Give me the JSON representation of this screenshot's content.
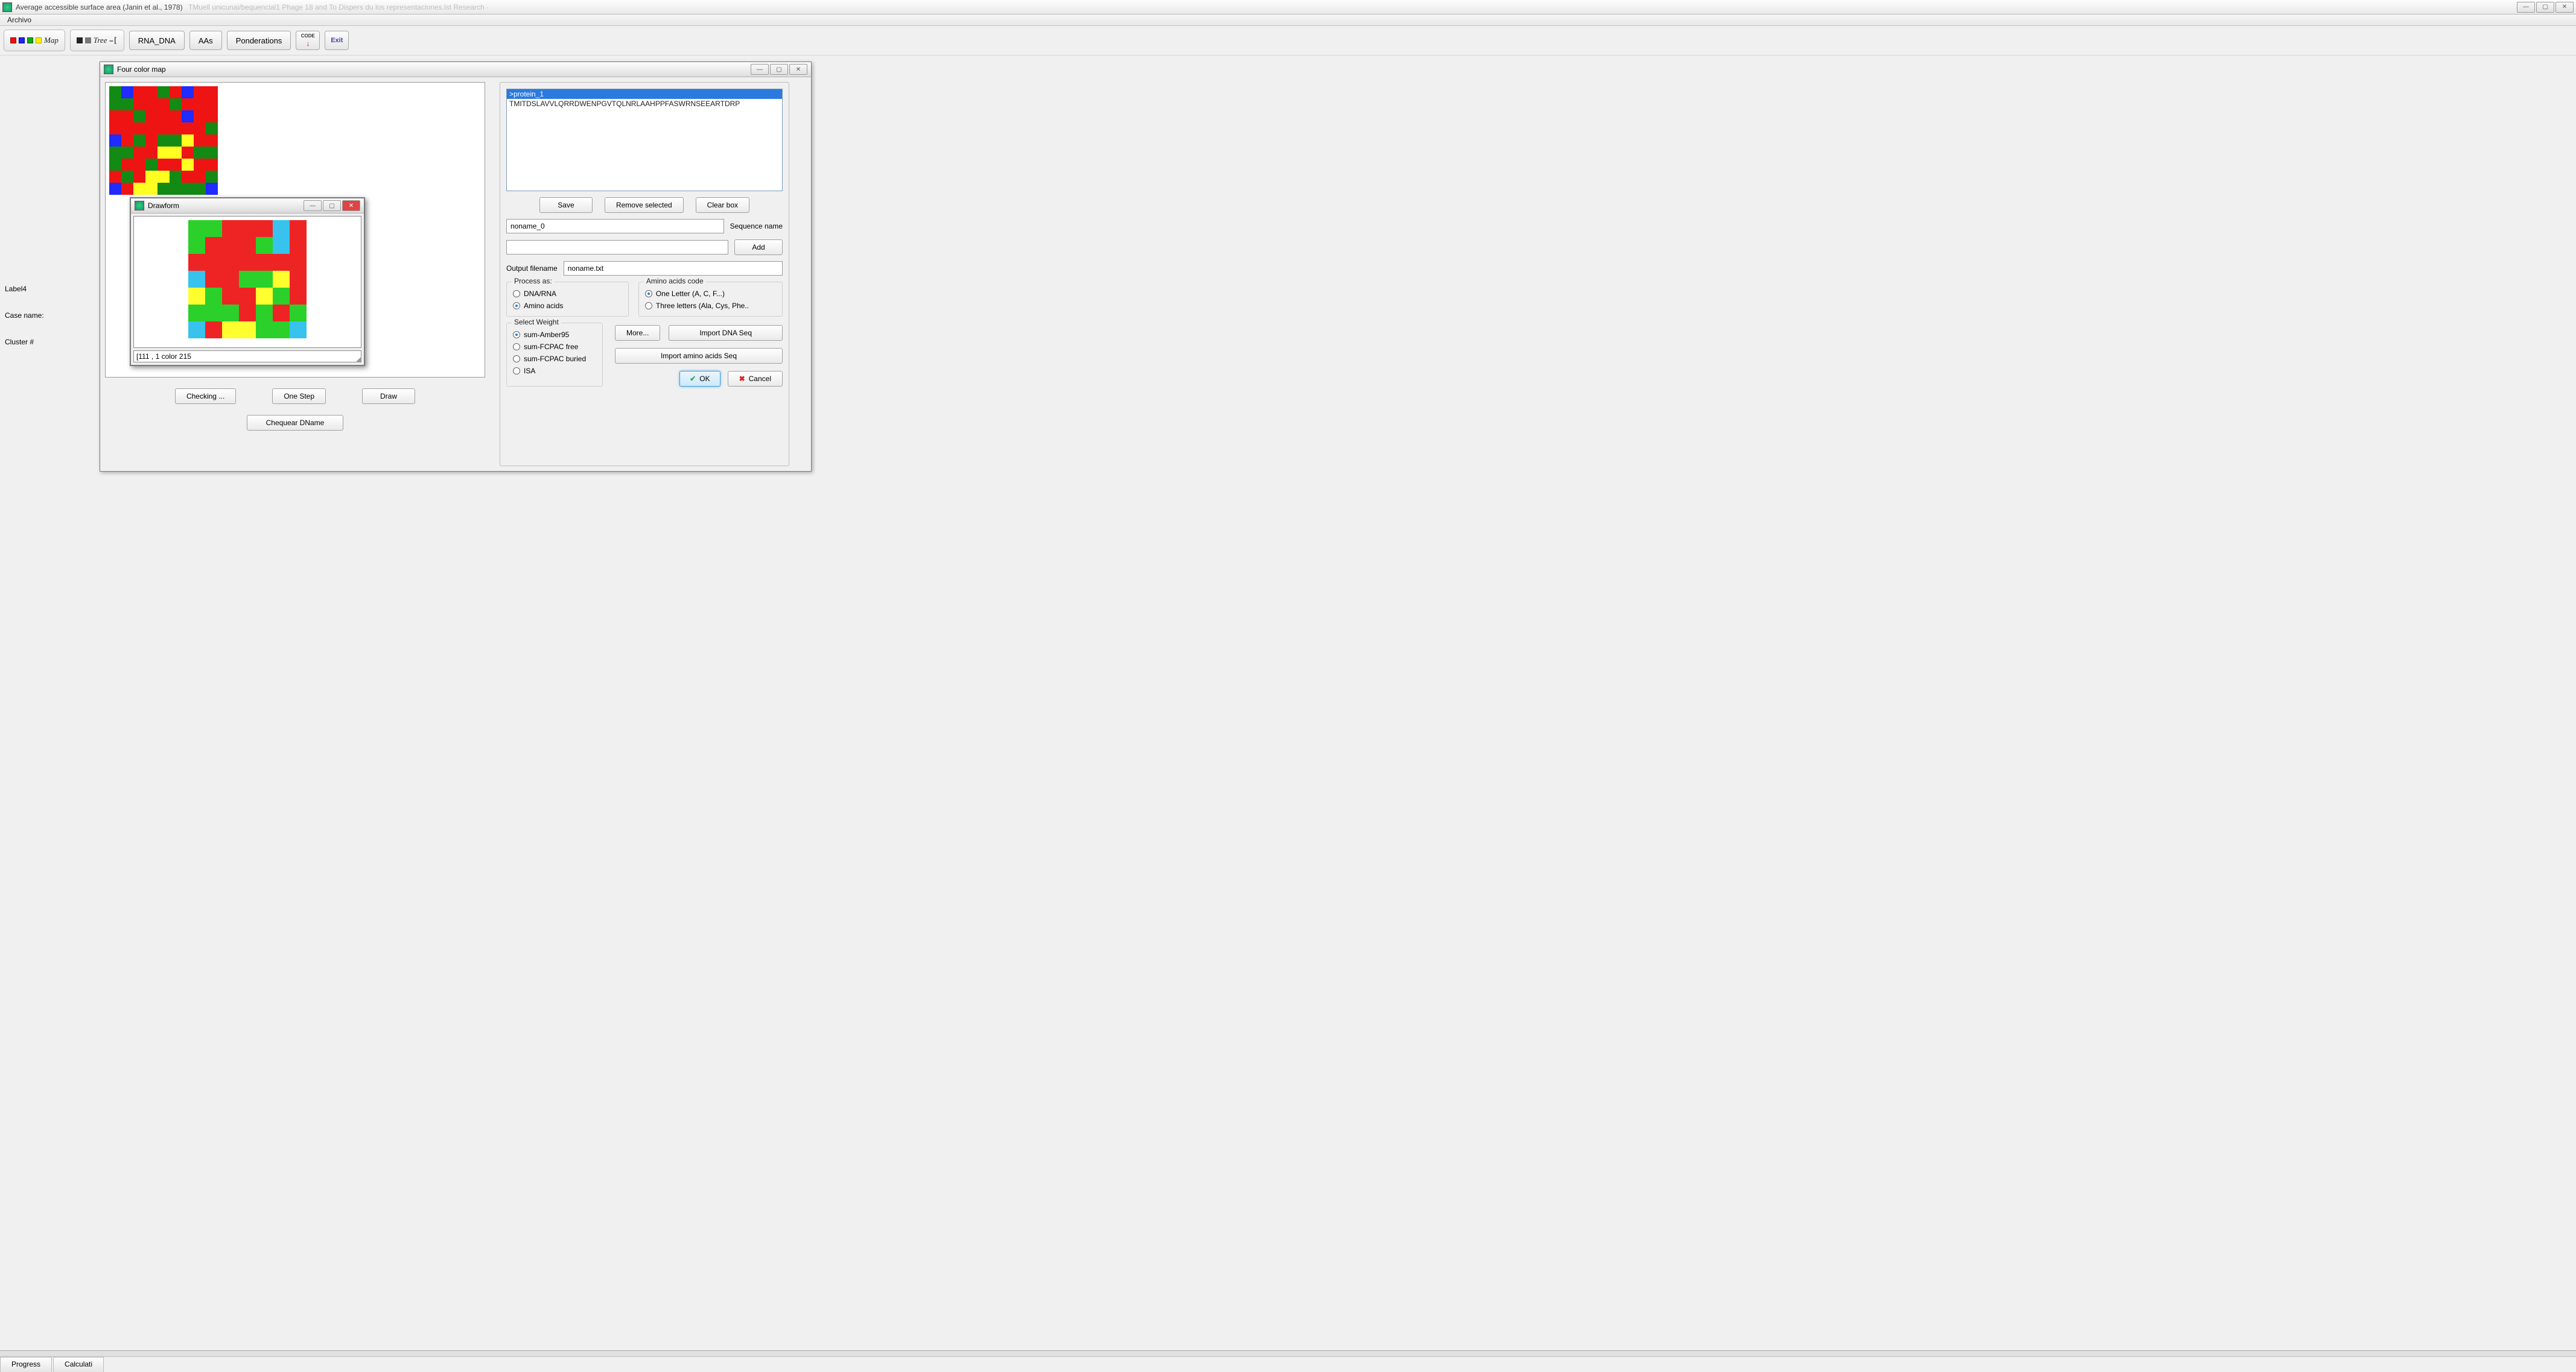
{
  "window": {
    "title": "Average accessible surface area (Janin et al., 1978)",
    "title_faded": "TMuell unicunai/bequencial1 Phage 18 and To Dispers du los representaciones.lst  Research ·"
  },
  "menubar": {
    "archivo": "Archivo"
  },
  "toolbar": {
    "map_label": "Map",
    "tree_label": "Tree",
    "rna_dna": "RNA_DNA",
    "aas": "AAs",
    "ponderations": "Ponderations",
    "code_top": "CODE",
    "exit_label": "Exit"
  },
  "side": {
    "label4": "Label4",
    "casename": "Case name:",
    "cluster": "Cluster #"
  },
  "fcm": {
    "title": "Four color map",
    "checking": "Checking ...",
    "onestep": "One Step",
    "draw": "Draw",
    "chequear": "Chequear DName"
  },
  "seq": {
    "sel": ">protein_1",
    "line": "TMITDSLAVVLQRRDWENPGVTQLNRLAAHPPFASWRNSEEARTDRP",
    "save": "Save",
    "remove": "Remove selected",
    "clear": "Clear box",
    "name_value": "noname_0",
    "name_label": "Sequence name",
    "add": "Add",
    "output_label": "Output filename",
    "output_value": "noname.txt",
    "process_as": "Process as:",
    "dna_rna": "DNA/RNA",
    "amino": "Amino acids",
    "aac_label": "Amino acids code",
    "one_letter": "One Letter (A, C, F...)",
    "three_letter": "Three letters (Ala, Cys, Phe..",
    "select_weight": "Select Weight",
    "w_amber": "sum-Amber95",
    "w_free": "sum-FCPAC free",
    "w_buried": "sum-FCPAC buried",
    "w_isa": "ISA",
    "more": "More...",
    "import_dna": "Import DNA Seq",
    "import_aa": "Import amino acids Seq",
    "ok": "OK",
    "cancel": "Cancel"
  },
  "drawform": {
    "title": "Drawform",
    "status": "[111 , 1 color 215"
  },
  "status": {
    "progress": "Progress",
    "calc": "Calculati"
  }
}
